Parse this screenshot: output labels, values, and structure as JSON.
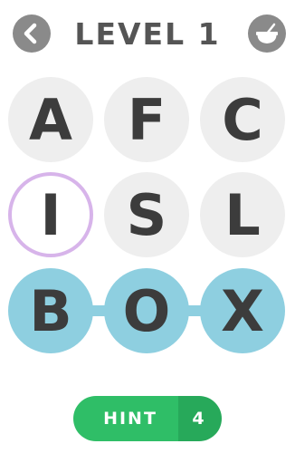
{
  "header": {
    "title": "LEVEL 1",
    "back_icon": "chevron-left-icon",
    "right_icon": "bowl-icon"
  },
  "board": {
    "rows": [
      [
        "A",
        "F",
        "C"
      ],
      [
        "I",
        "S",
        "L"
      ],
      [
        "B",
        "O",
        "X"
      ]
    ],
    "selected_word": "BOX",
    "highlighted_letter": "I"
  },
  "hint": {
    "label": "HINT",
    "count": "4"
  },
  "colors": {
    "tile": "#eeeeee",
    "tile_text": "#3c3c3c",
    "selected": "#8ecfe0",
    "highlight_ring": "#d7b4ea",
    "hint_green": "#2fbe67",
    "hint_green_dark": "#27a95a",
    "title": "#555555",
    "icon_button": "#8a8a8a"
  }
}
